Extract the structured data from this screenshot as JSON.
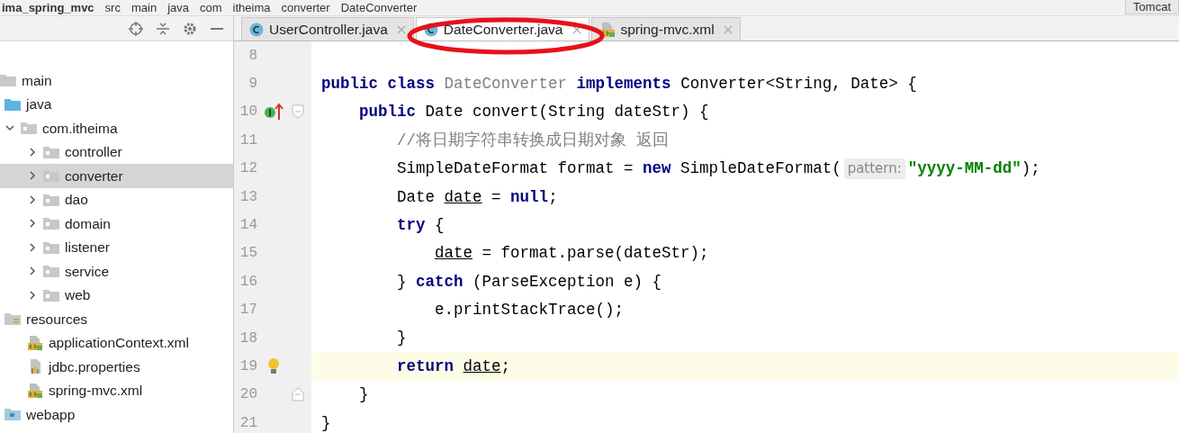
{
  "breadcrumb": [
    "ima_spring_mvc",
    "src",
    "main",
    "java",
    "com",
    "itheima",
    "converter",
    "DateConverter"
  ],
  "run_config": {
    "label": "Tomcat"
  },
  "tabs": [
    {
      "label": "UserController.java",
      "kind": "java",
      "selected": false,
      "circled": false
    },
    {
      "label": "DateConverter.java",
      "kind": "java",
      "selected": true,
      "circled": true
    },
    {
      "label": "spring-mvc.xml",
      "kind": "xml",
      "selected": false,
      "circled": false
    }
  ],
  "tree": [
    {
      "label": "main",
      "kind": "plain",
      "children": [
        {
          "label": "java",
          "kind": "source",
          "children": [
            {
              "label": "com.itheima",
              "kind": "package",
              "expanded": true,
              "children": [
                {
                  "label": "controller",
                  "kind": "package",
                  "expanded": false,
                  "selected": false
                },
                {
                  "label": "converter",
                  "kind": "package",
                  "expanded": false,
                  "selected": true
                },
                {
                  "label": "dao",
                  "kind": "package",
                  "expanded": false,
                  "selected": false
                },
                {
                  "label": "domain",
                  "kind": "package",
                  "expanded": false,
                  "selected": false
                },
                {
                  "label": "listener",
                  "kind": "package",
                  "expanded": false,
                  "selected": false
                },
                {
                  "label": "service",
                  "kind": "package",
                  "expanded": false,
                  "selected": false
                },
                {
                  "label": "web",
                  "kind": "package",
                  "expanded": false,
                  "selected": false
                }
              ]
            }
          ]
        },
        {
          "label": "resources",
          "kind": "resources",
          "children": [
            {
              "label": "applicationContext.xml",
              "kind": "xml"
            },
            {
              "label": "jdbc.properties",
              "kind": "properties"
            },
            {
              "label": "spring-mvc.xml",
              "kind": "xml"
            }
          ]
        },
        {
          "label": "webapp",
          "kind": "web"
        }
      ]
    }
  ],
  "code": [
    {
      "number": "8",
      "current": false
    },
    {
      "number": "9",
      "current": false,
      "tokens": [
        {
          "kind": "keyword",
          "text": "public class "
        },
        {
          "kind": "unused",
          "text": "DateConverter "
        },
        {
          "kind": "keyword",
          "text": "implements "
        },
        {
          "kind": "plain",
          "text": "Converter<String, Date> {"
        }
      ]
    },
    {
      "number": "10",
      "current": false,
      "markers": [
        {
          "kind": "implements"
        },
        {
          "kind": "fold_start"
        }
      ],
      "tokens": [
        {
          "kind": "keyword",
          "text": "    public"
        },
        {
          "kind": "plain",
          "text": " Date convert(String dateStr) {"
        }
      ]
    },
    {
      "number": "11",
      "current": false,
      "tokens": [
        {
          "kind": "comment",
          "text": "        //将日期字符串转换成日期对象 返回"
        }
      ]
    },
    {
      "number": "12",
      "current": false,
      "tokens": [
        {
          "kind": "plain",
          "text": "        SimpleDateFormat format = "
        },
        {
          "kind": "keyword",
          "text": "new"
        },
        {
          "kind": "plain",
          "text": " SimpleDateFormat("
        },
        {
          "kind": "hint",
          "text": "pattern:"
        },
        {
          "kind": "string",
          "text": "\"yyyy-MM-dd\""
        },
        {
          "kind": "plain",
          "text": ");"
        }
      ]
    },
    {
      "number": "13",
      "current": false,
      "tokens": [
        {
          "kind": "plain",
          "text": "        Date "
        },
        {
          "kind": "reassigned",
          "text": "date"
        },
        {
          "kind": "plain",
          "text": " = "
        },
        {
          "kind": "keyword",
          "text": "null"
        },
        {
          "kind": "plain",
          "text": ";"
        }
      ]
    },
    {
      "number": "14",
      "current": false,
      "tokens": [
        {
          "kind": "keyword",
          "text": "        try"
        },
        {
          "kind": "plain",
          "text": " {"
        }
      ]
    },
    {
      "number": "15",
      "current": false,
      "tokens": [
        {
          "kind": "reassigned",
          "text": "            date"
        },
        {
          "kind": "plain",
          "text": " = format.parse(dateStr);"
        }
      ]
    },
    {
      "number": "16",
      "current": false,
      "tokens": [
        {
          "kind": "plain",
          "text": "        } "
        },
        {
          "kind": "keyword",
          "text": "catch"
        },
        {
          "kind": "plain",
          "text": " (ParseException e) {"
        }
      ]
    },
    {
      "number": "17",
      "current": false,
      "tokens": [
        {
          "kind": "plain",
          "text": "            e.printStackTrace();"
        }
      ]
    },
    {
      "number": "18",
      "current": false,
      "tokens": [
        {
          "kind": "plain",
          "text": "        }"
        }
      ]
    },
    {
      "number": "19",
      "current": true,
      "markers": [
        {
          "kind": "bulb"
        }
      ],
      "tokens": [
        {
          "kind": "keyword",
          "text": "        return "
        },
        {
          "kind": "reassigned",
          "text": "date"
        },
        {
          "kind": "plain",
          "text": ";"
        }
      ]
    },
    {
      "number": "20",
      "current": false,
      "markers": [
        {
          "kind": "fold_end"
        }
      ],
      "tokens": [
        {
          "kind": "plain",
          "text": "    }"
        }
      ]
    },
    {
      "number": "21",
      "current": false,
      "tokens": [
        {
          "kind": "plain",
          "text": "}"
        }
      ]
    }
  ]
}
